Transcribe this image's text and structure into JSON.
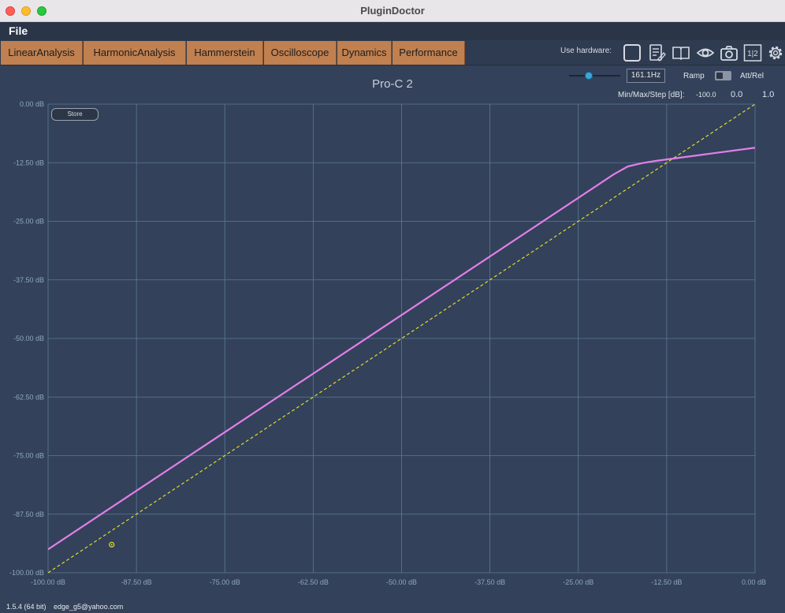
{
  "window": {
    "title": "PluginDoctor"
  },
  "menu": {
    "file": "File"
  },
  "tabs": [
    "LinearAnalysis",
    "HarmonicAnalysis",
    "Hammerstein",
    "Oscilloscope",
    "Dynamics",
    "Performance"
  ],
  "toolbar": {
    "use_hardware_label": "Use hardware:",
    "icons": [
      "hardware-checkbox-icon",
      "notes-icon",
      "manual-book-icon",
      "eye-icon",
      "camera-icon",
      "split-1-2-icon",
      "gear-icon"
    ],
    "split_label": "1|2"
  },
  "plugin": {
    "name": "Pro-C 2"
  },
  "controls": {
    "frequency": "161.1Hz",
    "frequency_slider_level": 0.38,
    "ramp_label": "Ramp",
    "att_rel_label": "Att/Rel",
    "min_max_step_label": "Min/Max/Step [dB]:",
    "min": "-100.0",
    "max": "0.0",
    "step": "1.0"
  },
  "store_button": "Store",
  "status": {
    "version": "1.5.4 (64 bit)",
    "email": "edge_g5@yahoo.com"
  },
  "colors": {
    "background": "#33415a",
    "grid": "#5d7a96",
    "response": "#e27fe8",
    "reference": "#dede2c",
    "tab_bg": "#c08050"
  },
  "chart_data": {
    "type": "line",
    "title": "Pro-C 2",
    "xlabel": "",
    "ylabel": "",
    "xlim": [
      -100,
      0
    ],
    "ylim": [
      -100,
      0
    ],
    "x_ticks": [
      "-100.00 dB",
      "-87.50 dB",
      "-75.00 dB",
      "-62.50 dB",
      "-50.00 dB",
      "-37.50 dB",
      "-25.00 dB",
      "-12.50 dB",
      "0.00 dB"
    ],
    "y_ticks": [
      "0.00 dB",
      "-12.50 dB",
      "-25.00 dB",
      "-37.50 dB",
      "-50.00 dB",
      "-62.50 dB",
      "-75.00 dB",
      "-87.50 dB",
      "-100.00 dB"
    ],
    "grid": true,
    "series": [
      {
        "style": "solid",
        "x": [
          -100,
          -50,
          -20,
          -18,
          -16,
          -14,
          -12,
          -10,
          -5,
          0
        ],
        "y": [
          -95,
          -45,
          -15,
          -13.3,
          -12.6,
          -12.1,
          -11.7,
          -11.3,
          -10.3,
          -9.3
        ]
      },
      {
        "style": "dashed",
        "x": [
          -100,
          0
        ],
        "y": [
          -100,
          0
        ]
      }
    ],
    "marker": {
      "x": -91,
      "y": -94
    }
  }
}
